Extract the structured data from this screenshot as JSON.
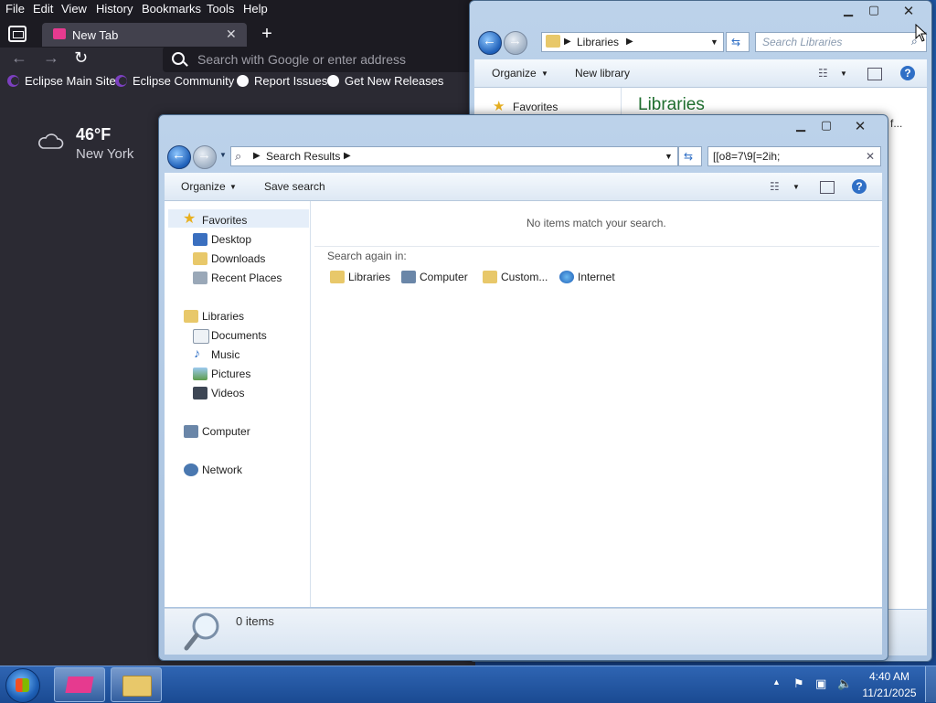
{
  "browser": {
    "menu": [
      "File",
      "Edit",
      "View",
      "History",
      "Bookmarks",
      "Tools",
      "Help"
    ],
    "tab_title": "New Tab",
    "url_placeholder": "Search with Google or enter address",
    "bookmarks": [
      "Eclipse Main Site",
      "Eclipse Community",
      "Report Issues",
      "Get New Releases"
    ],
    "weather": {
      "temp": "46°F",
      "city": "New York"
    }
  },
  "libraries_window": {
    "breadcrumb": "Libraries",
    "search_placeholder": "Search Libraries",
    "toolbar": {
      "organize": "Organize",
      "new_library": "New library"
    },
    "nav": {
      "favorites": "Favorites"
    },
    "heading": "Libraries",
    "obscured_text": "f..."
  },
  "search_window": {
    "breadcrumb": "Search Results",
    "search_query": "[[o8=7\\9[=2ih;",
    "toolbar": {
      "organize": "Organize",
      "save_search": "Save search"
    },
    "nav": {
      "favorites": "Favorites",
      "desktop": "Desktop",
      "downloads": "Downloads",
      "recent_places": "Recent Places",
      "libraries": "Libraries",
      "documents": "Documents",
      "music": "Music",
      "pictures": "Pictures",
      "videos": "Videos",
      "computer": "Computer",
      "network": "Network"
    },
    "no_items": "No items match your search.",
    "search_again": "Search again in:",
    "search_again_options": [
      "Libraries",
      "Computer",
      "Custom...",
      "Internet"
    ],
    "status": "0 items"
  },
  "taskbar": {
    "time": "4:40 AM",
    "date": "11/21/2025"
  }
}
